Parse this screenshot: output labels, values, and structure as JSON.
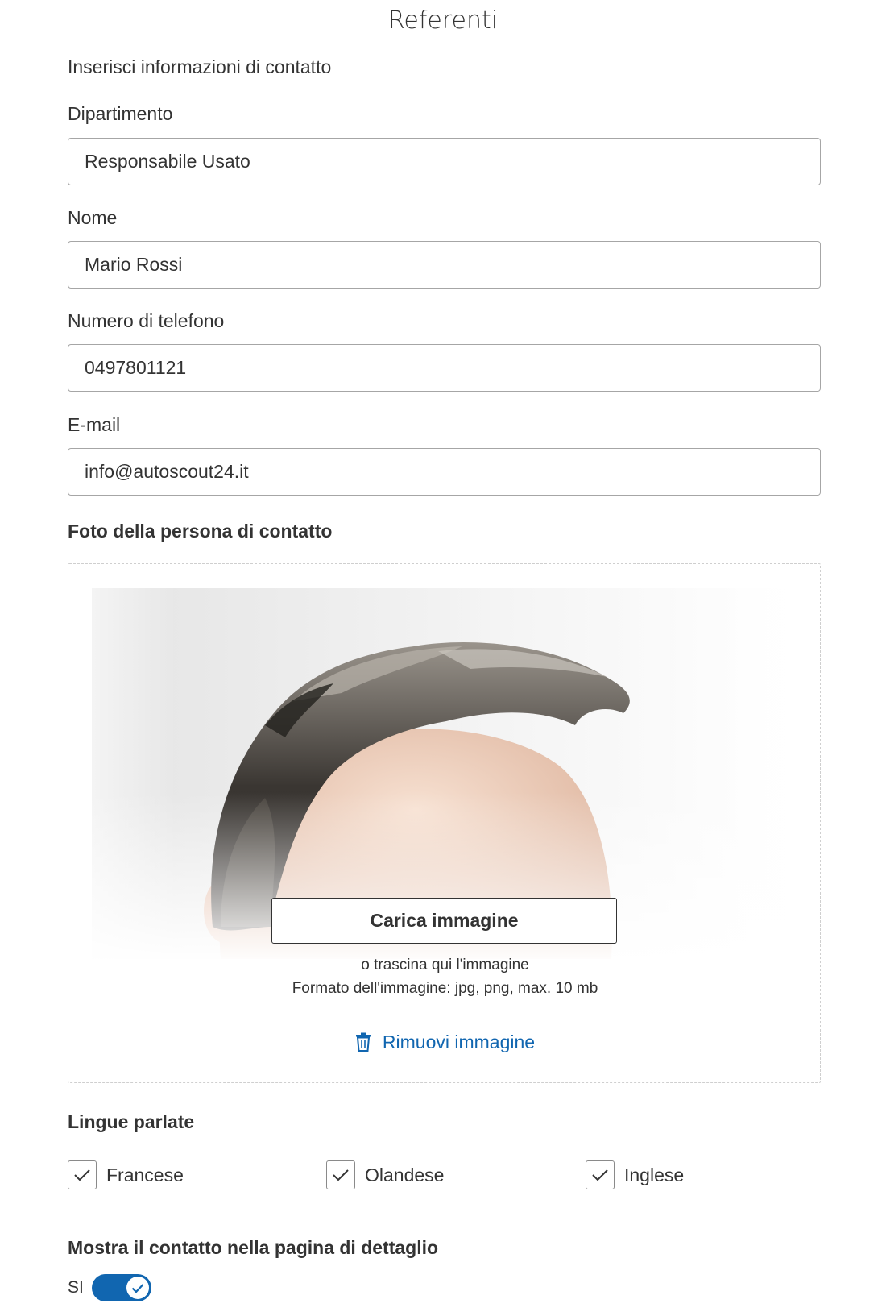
{
  "header": {
    "title": "Referenti",
    "subtitle": "Inserisci informazioni di contatto"
  },
  "fields": {
    "department": {
      "label": "Dipartimento",
      "value": "Responsabile Usato"
    },
    "name": {
      "label": "Nome",
      "value": "Mario Rossi"
    },
    "phone": {
      "label": "Numero di telefono",
      "value": "0497801121"
    },
    "email": {
      "label": "E-mail",
      "value": "info@autoscout24.it"
    }
  },
  "photo": {
    "section_label": "Foto della persona di contatto",
    "upload_button": "Carica immagine",
    "drag_hint": "o trascina qui l'immagine",
    "format_hint": "Formato dell'immagine: jpg, png, max. 10 mb",
    "remove_label": "Rimuovi immagine",
    "remove_icon": "trash-icon"
  },
  "languages": {
    "section_label": "Lingue parlate",
    "items": [
      {
        "label": "Francese",
        "checked": true
      },
      {
        "label": "Olandese",
        "checked": true
      },
      {
        "label": "Inglese",
        "checked": true
      }
    ]
  },
  "show_contact": {
    "section_label": "Mostra il contatto nella pagina di dettaglio",
    "toggle_label": "SI",
    "enabled": true
  },
  "colors": {
    "accent": "#1166b0",
    "border": "#a6a6a6",
    "text": "#333333"
  }
}
